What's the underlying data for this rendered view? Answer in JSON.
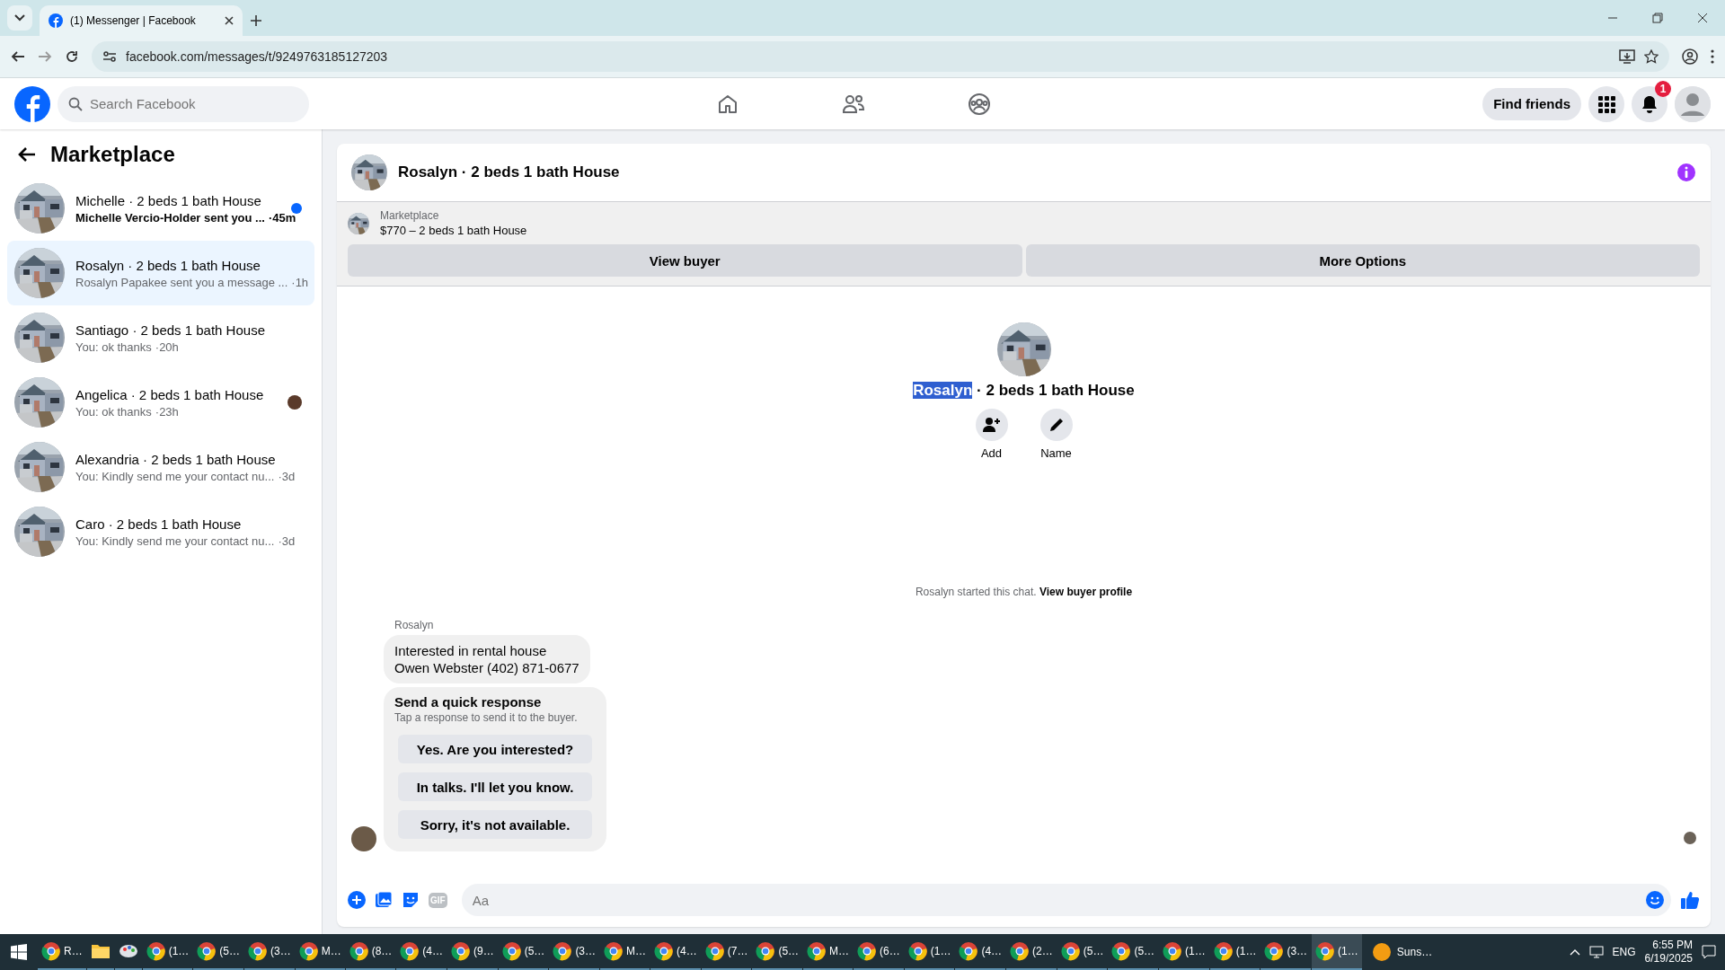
{
  "browser": {
    "tab_title": "(1) Messenger | Facebook",
    "url": "facebook.com/messages/t/9249763185127203"
  },
  "header": {
    "search": {
      "placeholder": "Search Facebook"
    },
    "nav": [
      {
        "kind": "home",
        "selected": false
      },
      {
        "kind": "friends",
        "selected": false
      },
      {
        "kind": "groups",
        "selected": false
      }
    ],
    "find_friends": "Find friends",
    "notification_count": "1"
  },
  "sidebar": {
    "title": "Marketplace",
    "conversations": [
      {
        "name": "Michelle · 2 beds 1 bath House",
        "preview": "Michelle Vercio-Holder sent you ...",
        "time": "·45m",
        "selected": false,
        "unread": true,
        "seen": false
      },
      {
        "name": "Rosalyn · 2 beds 1 bath House",
        "preview": "Rosalyn Papakee sent you a message ...",
        "time": "·1h",
        "selected": true,
        "unread": false,
        "seen": false
      },
      {
        "name": "Santiago · 2 beds 1 bath House",
        "preview": "You: ok thanks",
        "time": "·20h",
        "selected": false,
        "unread": false,
        "seen": false
      },
      {
        "name": "Angelica · 2 beds 1 bath House",
        "preview": "You: ok thanks",
        "time": "·23h",
        "selected": false,
        "unread": false,
        "seen": true
      },
      {
        "name": "Alexandria · 2 beds 1 bath House",
        "preview": "You: Kindly send me your contact nu...",
        "time": "·3d",
        "selected": false,
        "unread": false,
        "seen": false
      },
      {
        "name": "Caro · 2 beds 1 bath House",
        "preview": "You: Kindly send me your contact nu...",
        "time": "·3d",
        "selected": false,
        "unread": false,
        "seen": false
      }
    ]
  },
  "chat": {
    "title": "Rosalyn · 2 beds 1 bath House",
    "listing": {
      "source": "Marketplace",
      "item": "$770 – 2 beds 1 bath House"
    },
    "actions": [
      "View buyer",
      "More Options"
    ],
    "profile": {
      "title_parts": [
        {
          "text": "Rosalyn",
          "highlighted": true
        },
        {
          "text": " · 2 beds 1 bath House",
          "highlighted": false
        }
      ],
      "buttons": [
        {
          "kind": "add",
          "label": "Add"
        },
        {
          "kind": "name",
          "label": "Name"
        }
      ]
    },
    "started_note": "Rosalyn started this chat.",
    "started_link": "View buyer profile",
    "sender": "Rosalyn",
    "message": [
      "Interested in rental house",
      "Owen Webster (402) 871-0677"
    ],
    "quick": {
      "title": "Send a quick response",
      "hint": "Tap a response to send it to the buyer.",
      "responses": [
        "Yes. Are you interested?",
        "In talks. I'll let you know.",
        "Sorry, it's not available."
      ]
    },
    "composer": {
      "placeholder": "Aa",
      "gif_label": "GIF"
    }
  },
  "taskbar": {
    "apps": [
      {
        "kind": "chrome",
        "label": "R…",
        "selected": false
      },
      {
        "kind": "folder",
        "selected": false
      },
      {
        "kind": "paint",
        "selected": false
      },
      {
        "kind": "chrome",
        "label": "(1…",
        "selected": false
      },
      {
        "kind": "chrome",
        "label": "(5…",
        "selected": false
      },
      {
        "kind": "chrome",
        "label": "(3…",
        "selected": false
      },
      {
        "kind": "chrome",
        "label": "M…",
        "selected": false
      },
      {
        "kind": "chrome",
        "label": "(8…",
        "selected": false
      },
      {
        "kind": "chrome",
        "label": "(4…",
        "selected": false
      },
      {
        "kind": "chrome",
        "label": "(9…",
        "selected": false
      },
      {
        "kind": "chrome",
        "label": "(5…",
        "selected": false
      },
      {
        "kind": "chrome",
        "label": "(3…",
        "selected": false
      },
      {
        "kind": "chrome",
        "label": "M…",
        "selected": false
      },
      {
        "kind": "chrome",
        "label": "(4…",
        "selected": false
      },
      {
        "kind": "chrome",
        "label": "(7…",
        "selected": false
      },
      {
        "kind": "chrome",
        "label": "(5…",
        "selected": false
      },
      {
        "kind": "chrome",
        "label": "M…",
        "selected": false
      },
      {
        "kind": "chrome",
        "label": "(6…",
        "selected": false
      },
      {
        "kind": "chrome",
        "label": "(1…",
        "selected": false
      },
      {
        "kind": "chrome",
        "label": "(4…",
        "selected": false
      },
      {
        "kind": "chrome",
        "label": "(2…",
        "selected": false
      },
      {
        "kind": "chrome",
        "label": "(5…",
        "selected": false
      },
      {
        "kind": "chrome",
        "label": "(5…",
        "selected": false
      },
      {
        "kind": "chrome",
        "label": "(1…",
        "selected": false
      },
      {
        "kind": "chrome",
        "label": "(1…",
        "selected": false
      },
      {
        "kind": "chrome",
        "label": "(3…",
        "selected": false
      },
      {
        "kind": "chrome",
        "label": "(1…",
        "selected": true
      }
    ],
    "weather": "Suns…",
    "language": "ENG",
    "time": "6:55 PM",
    "date": "6/19/2025"
  }
}
